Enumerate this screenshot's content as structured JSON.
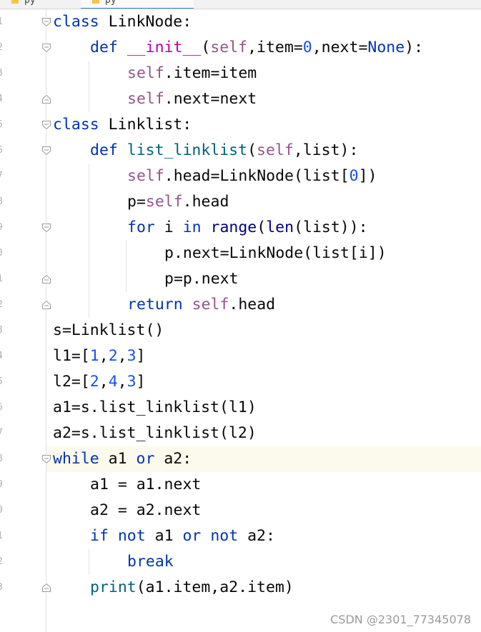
{
  "tabs": [
    {
      "label": "py"
    },
    {
      "label": "py"
    }
  ],
  "colors": {
    "keyword": "#0033b3",
    "self": "#94558d",
    "number": "#1750eb",
    "function": "#00627a",
    "dunder": "#b200b2",
    "builtin": "#000080",
    "current_line": "#fcfaed"
  },
  "gutter": {
    "line_numbers": [
      "1",
      "2",
      "3",
      "4",
      "5",
      "6",
      "7",
      "8",
      "9",
      "0",
      "1",
      "2",
      "3",
      "4",
      "5",
      "6",
      "7",
      "8",
      "9",
      "0",
      "1",
      "2",
      "3"
    ]
  },
  "code": {
    "l1": {
      "a": "class",
      "b": " LinkNode:"
    },
    "l2": {
      "a": "def",
      "b": " ",
      "c": "__init__",
      "d": "(",
      "e": "self",
      "f": ",item=",
      "g": "0",
      "h": ",next=",
      "i": "None",
      "j": "):"
    },
    "l3": {
      "a": "self",
      "b": ".item=item"
    },
    "l4": {
      "a": "self",
      "b": ".next=next"
    },
    "l5": {
      "a": "class",
      "b": " Linklist:"
    },
    "l6": {
      "a": "def",
      "b": " ",
      "c": "list_linklist",
      "d": "(",
      "e": "self",
      "f": ",list):"
    },
    "l7": {
      "a": "self",
      "b": ".head=LinkNode(list[",
      "c": "0",
      "d": "])"
    },
    "l8": {
      "a": "p=",
      "b": "self",
      "c": ".head"
    },
    "l9": {
      "a": "for",
      "b": " i ",
      "c": "in",
      "d": " ",
      "e": "range",
      "f": "(",
      "g": "len",
      "h": "(list)):"
    },
    "l10": {
      "a": "p.next=LinkNode(list[i])"
    },
    "l11": {
      "a": "p=p.next"
    },
    "l12": {
      "a": "return",
      "b": " ",
      "c": "self",
      "d": ".head"
    },
    "l13": {
      "a": "s=Linklist()"
    },
    "l14": {
      "a": "l1=[",
      "b": "1",
      "c": ",",
      "d": "2",
      "e": ",",
      "f": "3",
      "g": "]"
    },
    "l15": {
      "a": "l2=[",
      "b": "2",
      "c": ",",
      "d": "4",
      "e": ",",
      "f": "3",
      "g": "]"
    },
    "l16": {
      "a": "a1=s.list_linklist(l1)"
    },
    "l17": {
      "a": "a2=s.list_linklist(l2)"
    },
    "l18": {
      "a": "while",
      "b": " a1 ",
      "c": "or",
      "d": " a2:"
    },
    "l19": {
      "a": "a1 = a1.next"
    },
    "l20": {
      "a": "a2 = a2.next"
    },
    "l21": {
      "a": "if",
      "b": " ",
      "c": "not",
      "d": " a1 ",
      "e": "or",
      "f": " ",
      "g": "not",
      "h": " a2:"
    },
    "l22": {
      "a": "break"
    },
    "l23": {
      "a": "print",
      "b": "(a1.item,a2.item)"
    }
  },
  "watermark": "CSDN @2301_77345078"
}
